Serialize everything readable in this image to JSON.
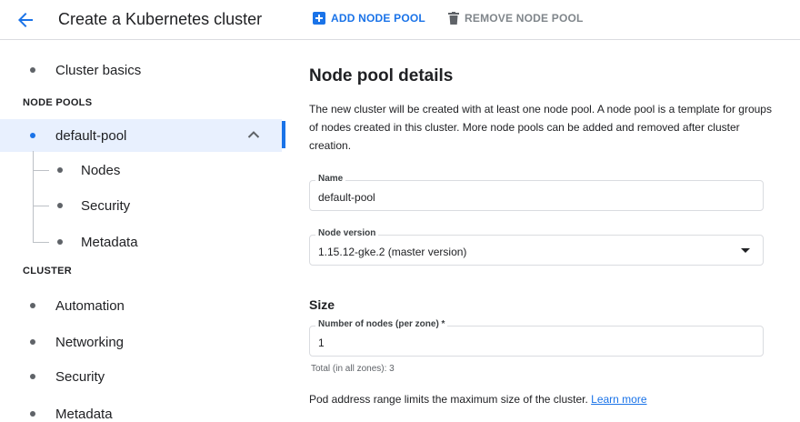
{
  "header": {
    "title": "Create a Kubernetes cluster",
    "add_label": "ADD NODE POOL",
    "remove_label": "REMOVE NODE POOL"
  },
  "sidebar": {
    "cluster_basics": "Cluster basics",
    "node_pools_section": "NODE POOLS",
    "default_pool": "default-pool",
    "pool_children": [
      "Nodes",
      "Security",
      "Metadata"
    ],
    "cluster_section": "CLUSTER",
    "cluster_items": [
      "Automation",
      "Networking",
      "Security",
      "Metadata"
    ]
  },
  "main": {
    "heading": "Node pool details",
    "description": "The new cluster will be created with at least one node pool. A node pool is a template for groups of nodes created in this cluster. More node pools can be added and removed after cluster creation.",
    "name_label": "Name",
    "name_value": "default-pool",
    "version_label": "Node version",
    "version_value": "1.15.12-gke.2 (master version)",
    "size_heading": "Size",
    "nodes_label": "Number of nodes (per zone) *",
    "nodes_value": "1",
    "nodes_hint": "Total (in all zones): 3",
    "pod_text": "Pod address range limits the maximum size of the cluster.",
    "learn_more": "Learn more"
  },
  "colors": {
    "accent": "#1a73e8",
    "selected_bg": "#e8f0fe",
    "muted": "#5f6368"
  }
}
